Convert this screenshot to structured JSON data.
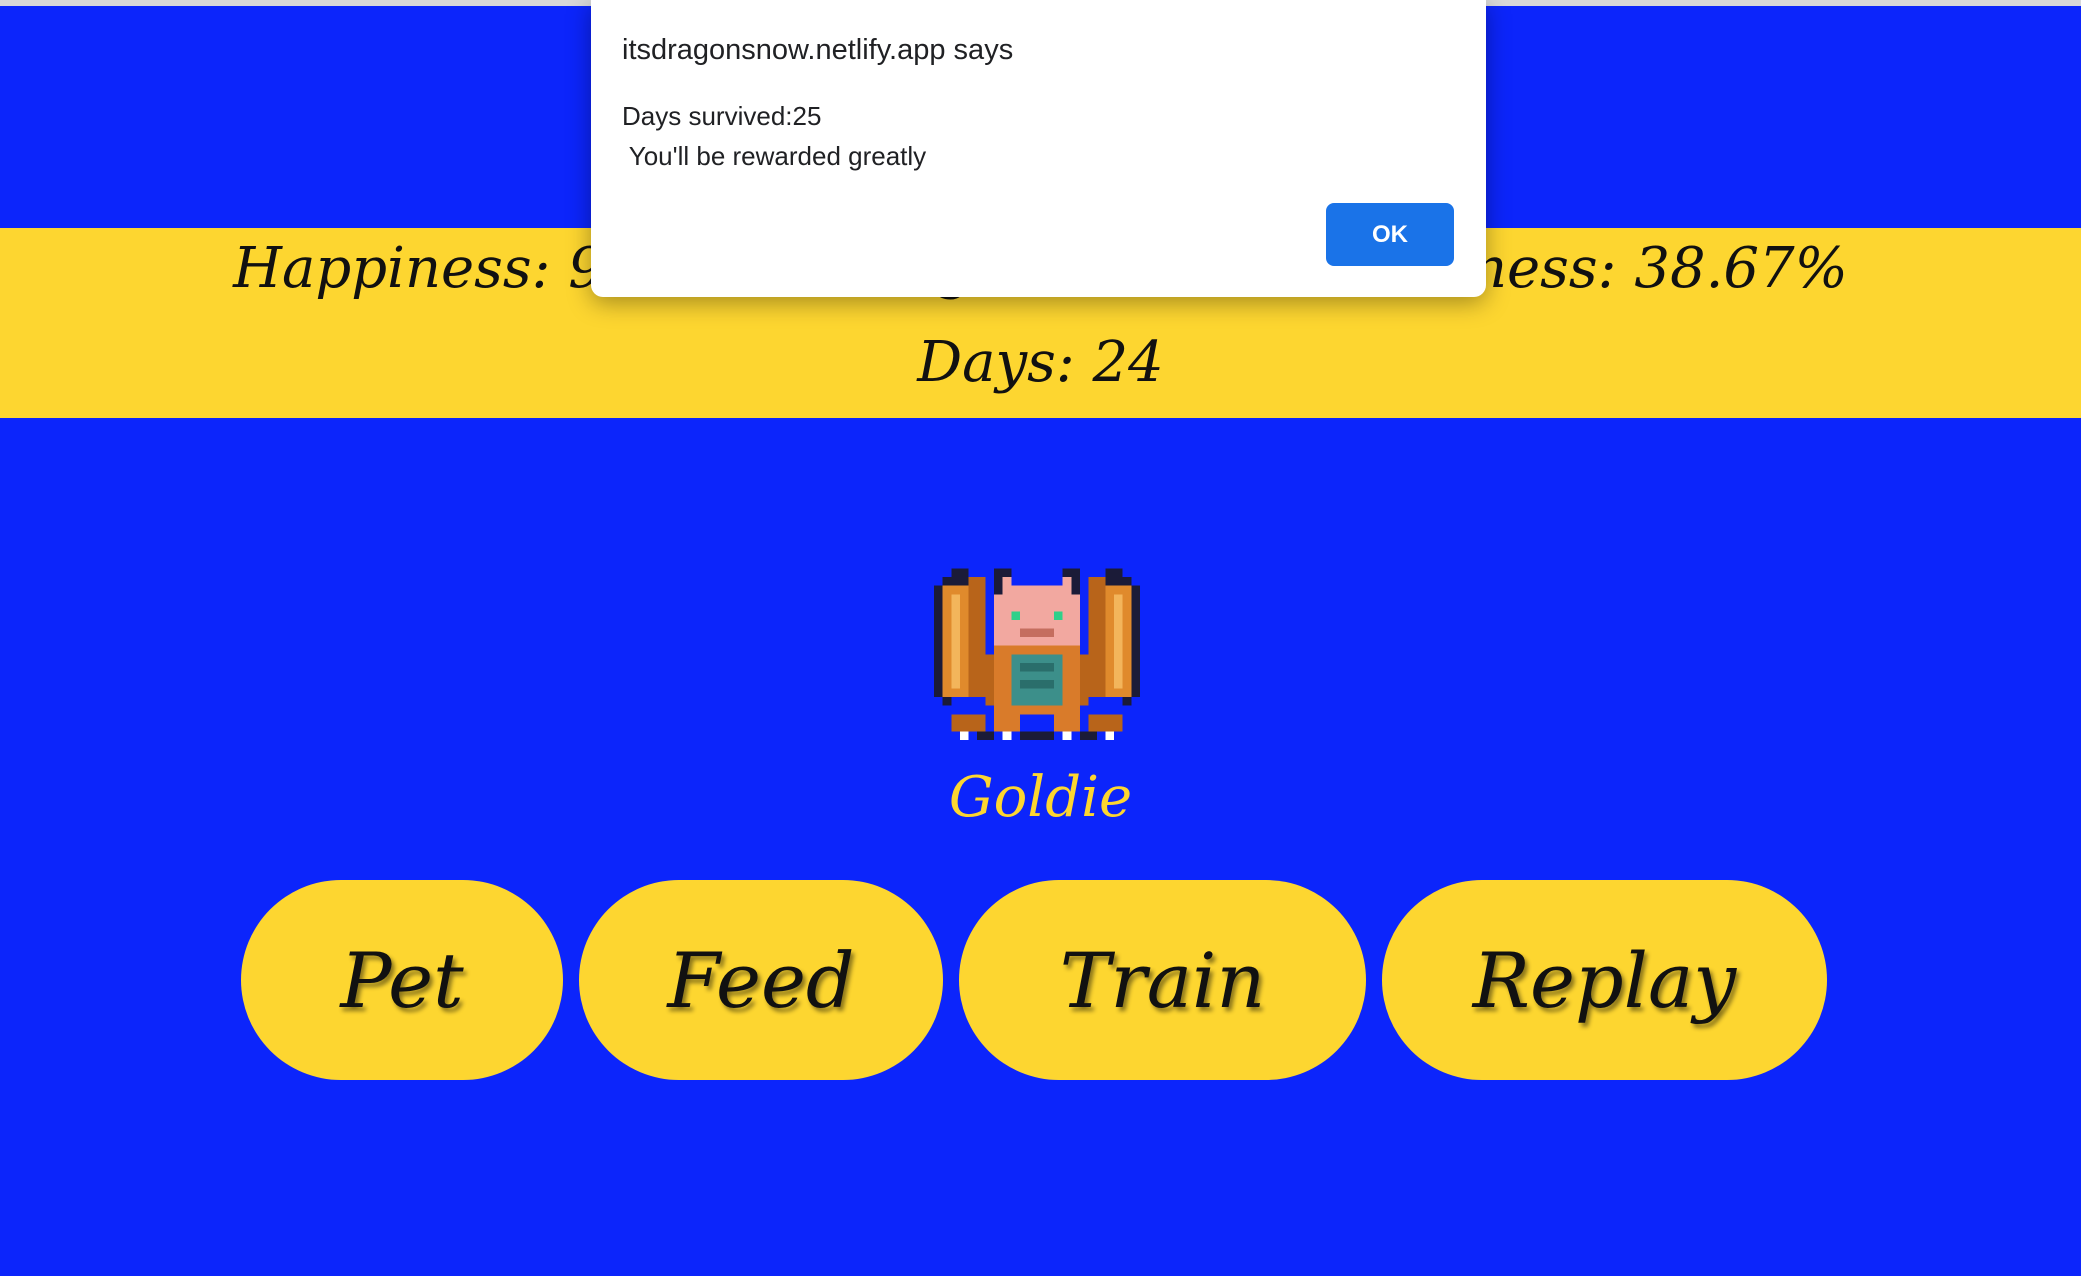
{
  "stats": {
    "line1": "Happiness: 93.33%, Hunger: 34.67%, Tiredness: 38.67%",
    "line2": "Days: 24"
  },
  "pet": {
    "name": "Goldie",
    "sprite_icon": "dragon-sprite-icon"
  },
  "buttons": {
    "pet": "Pet",
    "feed": "Feed",
    "train": "Train",
    "replay": "Replay"
  },
  "dialog": {
    "title": "itsdragonsnow.netlify.app says",
    "message": "Days survived:25\n You'll be rewarded greatly",
    "ok_label": "OK"
  },
  "colors": {
    "background": "#0c25fb",
    "accent": "#fdd630",
    "dialog_button": "#1a73e8"
  }
}
